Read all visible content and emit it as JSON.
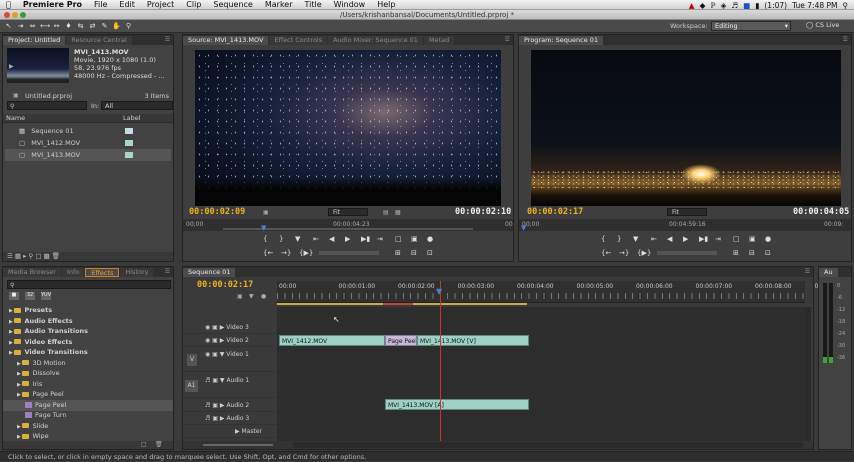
{
  "menubar": {
    "apple": "",
    "app": "Premiere Pro",
    "items": [
      "File",
      "Edit",
      "Project",
      "Clip",
      "Sequence",
      "Marker",
      "Title",
      "Window",
      "Help"
    ],
    "battery": "(1:07)",
    "clock": "Tue 7:48 PM"
  },
  "window": {
    "title": "/Users/krishanbansal/Documents/Untitled.prproj *"
  },
  "workspace": {
    "label": "Workspace:",
    "value": "Editing",
    "cslive": "CS Live"
  },
  "project": {
    "tabs": [
      "Project: Untitled",
      "Resource Central"
    ],
    "clip_name": "MVI_1413.MOV",
    "clip_info": [
      "Movie, 1920 x 1080 (1.0)",
      "58, 23.976 fps",
      "48000 Hz - Compressed - ..."
    ],
    "file": "Untitled.prproj",
    "items_count": "3 Items",
    "in_label": "In:",
    "in_value": "All",
    "col_name": "Name",
    "col_label": "Label",
    "items": [
      {
        "name": "Sequence 01",
        "color": "#c8d8e0"
      },
      {
        "name": "MVI_1412.MOV",
        "color": "#a8d8c8"
      },
      {
        "name": "MVI_1413.MOV",
        "color": "#a8d8c8"
      }
    ]
  },
  "source": {
    "tabs": [
      "Source: MVI_1413.MOV",
      "Effect Controls",
      "Audio Mixer: Sequence 01",
      "Metad"
    ],
    "tc_in": "00:00:02:09",
    "fit": "Fit",
    "tc_dur": "00:00:02:10",
    "ruler_left": "00;00",
    "ruler_mid": "00:00:04:23",
    "ruler_right": "00"
  },
  "program": {
    "tab": "Program: Sequence 01",
    "tc_in": "00:00:02:17",
    "fit": "Fit",
    "tc_dur": "00:00:04:05",
    "ruler_left": "00;00",
    "ruler_mid": "00:04:59:16",
    "ruler_right": "00:09:"
  },
  "effects": {
    "tabs": [
      "Media Browser",
      "Info",
      "Effects",
      "History"
    ],
    "tree": [
      {
        "label": "Presets",
        "indent": 0,
        "bold": true,
        "type": "folder"
      },
      {
        "label": "Audio Effects",
        "indent": 0,
        "bold": true,
        "type": "folder"
      },
      {
        "label": "Audio Transitions",
        "indent": 0,
        "bold": true,
        "type": "folder"
      },
      {
        "label": "Video Effects",
        "indent": 0,
        "bold": true,
        "type": "folder"
      },
      {
        "label": "Video Transitions",
        "indent": 0,
        "bold": true,
        "type": "folder"
      },
      {
        "label": "3D Motion",
        "indent": 1,
        "bold": false,
        "type": "folder"
      },
      {
        "label": "Dissolve",
        "indent": 1,
        "bold": false,
        "type": "folder"
      },
      {
        "label": "Iris",
        "indent": 1,
        "bold": false,
        "type": "folder"
      },
      {
        "label": "Page Peel",
        "indent": 1,
        "bold": false,
        "type": "folder"
      },
      {
        "label": "Page Peel",
        "indent": 2,
        "bold": false,
        "type": "effect"
      },
      {
        "label": "Page Turn",
        "indent": 2,
        "bold": false,
        "type": "effect"
      },
      {
        "label": "Slide",
        "indent": 1,
        "bold": false,
        "type": "folder"
      },
      {
        "label": "Wipe",
        "indent": 1,
        "bold": false,
        "type": "folder"
      }
    ]
  },
  "timeline": {
    "tab": "Sequence 01",
    "tc": "00:00:02:17",
    "ruler": [
      "00:00",
      "00:00:01:00",
      "00:00:02:00",
      "00:00:03:00",
      "00:00:04:00",
      "00:00:05:00",
      "00:00:06:00",
      "00:00:07:00",
      "00:00:08:00",
      "00:"
    ],
    "tracks": [
      "Video 3",
      "Video 2",
      "Video 1",
      "Audio 1",
      "Audio 2",
      "Audio 3",
      "Master"
    ],
    "v_label": "V",
    "a_label": "A1",
    "clips": {
      "v2a": "MVI_1412.MOV",
      "transition": "Page Peel",
      "v2b": "MVI_1413.MOV [V]",
      "a2": "MVI_1413.MOV [A]"
    }
  },
  "audio_meter": {
    "tab": "Au",
    "scale": [
      "0",
      "-6",
      "-12",
      "-18",
      "-24",
      "-30",
      "-36"
    ]
  },
  "status": "Click to select, or click in empty space and drag to marquee select. Use Shift, Opt, and Cmd for other options."
}
